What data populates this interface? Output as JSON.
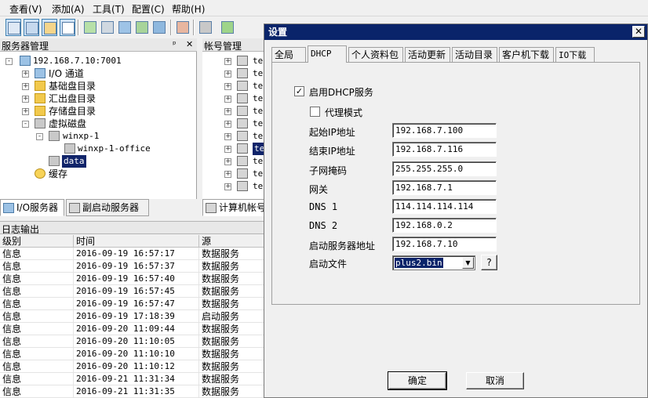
{
  "menubar": {
    "items": [
      "查看(V)",
      "添加(A)",
      "工具(T)",
      "配置(C)",
      "帮助(H)"
    ]
  },
  "toolbar": {
    "icons": [
      "grid-view-icon",
      "user-list-icon",
      "card-icon",
      "document-icon",
      "add-disk-icon",
      "disk-icon",
      "network-icon",
      "users-icon",
      "monitor-icon",
      "report-icon",
      "tools-icon",
      "refresh-icon"
    ]
  },
  "server_panel": {
    "title": "服务器管理",
    "pin": "ᵖ",
    "close": "✕",
    "tree": [
      {
        "label": "192.168.7.10:7001",
        "icon": "server-icon"
      },
      {
        "label": "I/O 通道",
        "icon": "io-channel-icon"
      },
      {
        "label": "基础盘目录",
        "icon": "folder-icon"
      },
      {
        "label": "汇出盘目录",
        "icon": "folder-icon"
      },
      {
        "label": "存储盘目录",
        "icon": "folder-icon"
      },
      {
        "label": "虚拟磁盘",
        "icon": "disk-icon"
      },
      {
        "label": "winxp-1",
        "icon": "disk-icon"
      },
      {
        "label": "winxp-1-office",
        "icon": "disk-icon"
      },
      {
        "label": "data",
        "icon": "disk-icon"
      },
      {
        "label": "缓存",
        "icon": "cache-icon"
      }
    ],
    "tabs": [
      "I/O服务器",
      "副启动服务器"
    ]
  },
  "account_panel": {
    "title": "帐号管理",
    "row_label": "te",
    "tab": "计算机帐号"
  },
  "log": {
    "title": "日志输出",
    "headers": [
      "级别",
      "时间",
      "源"
    ],
    "rows": [
      [
        "信息",
        "2016-09-19 16:57:17",
        "数据服务"
      ],
      [
        "信息",
        "2016-09-19 16:57:37",
        "数据服务"
      ],
      [
        "信息",
        "2016-09-19 16:57:40",
        "数据服务"
      ],
      [
        "信息",
        "2016-09-19 16:57:45",
        "数据服务"
      ],
      [
        "信息",
        "2016-09-19 16:57:47",
        "数据服务"
      ],
      [
        "信息",
        "2016-09-19 17:18:39",
        "启动服务"
      ],
      [
        "信息",
        "2016-09-20 11:09:44",
        "数据服务"
      ],
      [
        "信息",
        "2016-09-20 11:10:05",
        "数据服务"
      ],
      [
        "信息",
        "2016-09-20 11:10:10",
        "数据服务"
      ],
      [
        "信息",
        "2016-09-20 11:10:12",
        "数据服务"
      ],
      [
        "信息",
        "2016-09-21 11:31:34",
        "数据服务"
      ],
      [
        "信息",
        "2016-09-21 11:31:35",
        "数据服务"
      ]
    ]
  },
  "dialog": {
    "title": "设置",
    "close": "✕",
    "tabs": [
      "全局",
      "DHCP",
      "个人资料包",
      "活动更新",
      "活动目录",
      "客户机下载",
      "IO下载"
    ],
    "active_tab": "DHCP",
    "enable_dhcp": {
      "label": "启用DHCP服务",
      "checked": "✓"
    },
    "proxy_mode": {
      "label": "代理模式",
      "checked": ""
    },
    "fields": [
      {
        "label": "起始IP地址",
        "value": "192.168.7.100"
      },
      {
        "label": "结束IP地址",
        "value": "192.168.7.116"
      },
      {
        "label": "子网掩码",
        "value": "255.255.255.0"
      },
      {
        "label": "网关",
        "value": "192.168.7.1"
      },
      {
        "label": "DNS 1",
        "value": "114.114.114.114"
      },
      {
        "label": "DNS 2",
        "value": "192.168.0.2"
      },
      {
        "label": "启动服务器地址",
        "value": "192.168.7.10"
      }
    ],
    "boot_file": {
      "label": "启动文件",
      "value": "plus2.bin",
      "help": "?"
    },
    "ok": "确定",
    "cancel": "取消"
  },
  "colors": {
    "selection": "#0a246a",
    "window": "#f0f0f0"
  }
}
